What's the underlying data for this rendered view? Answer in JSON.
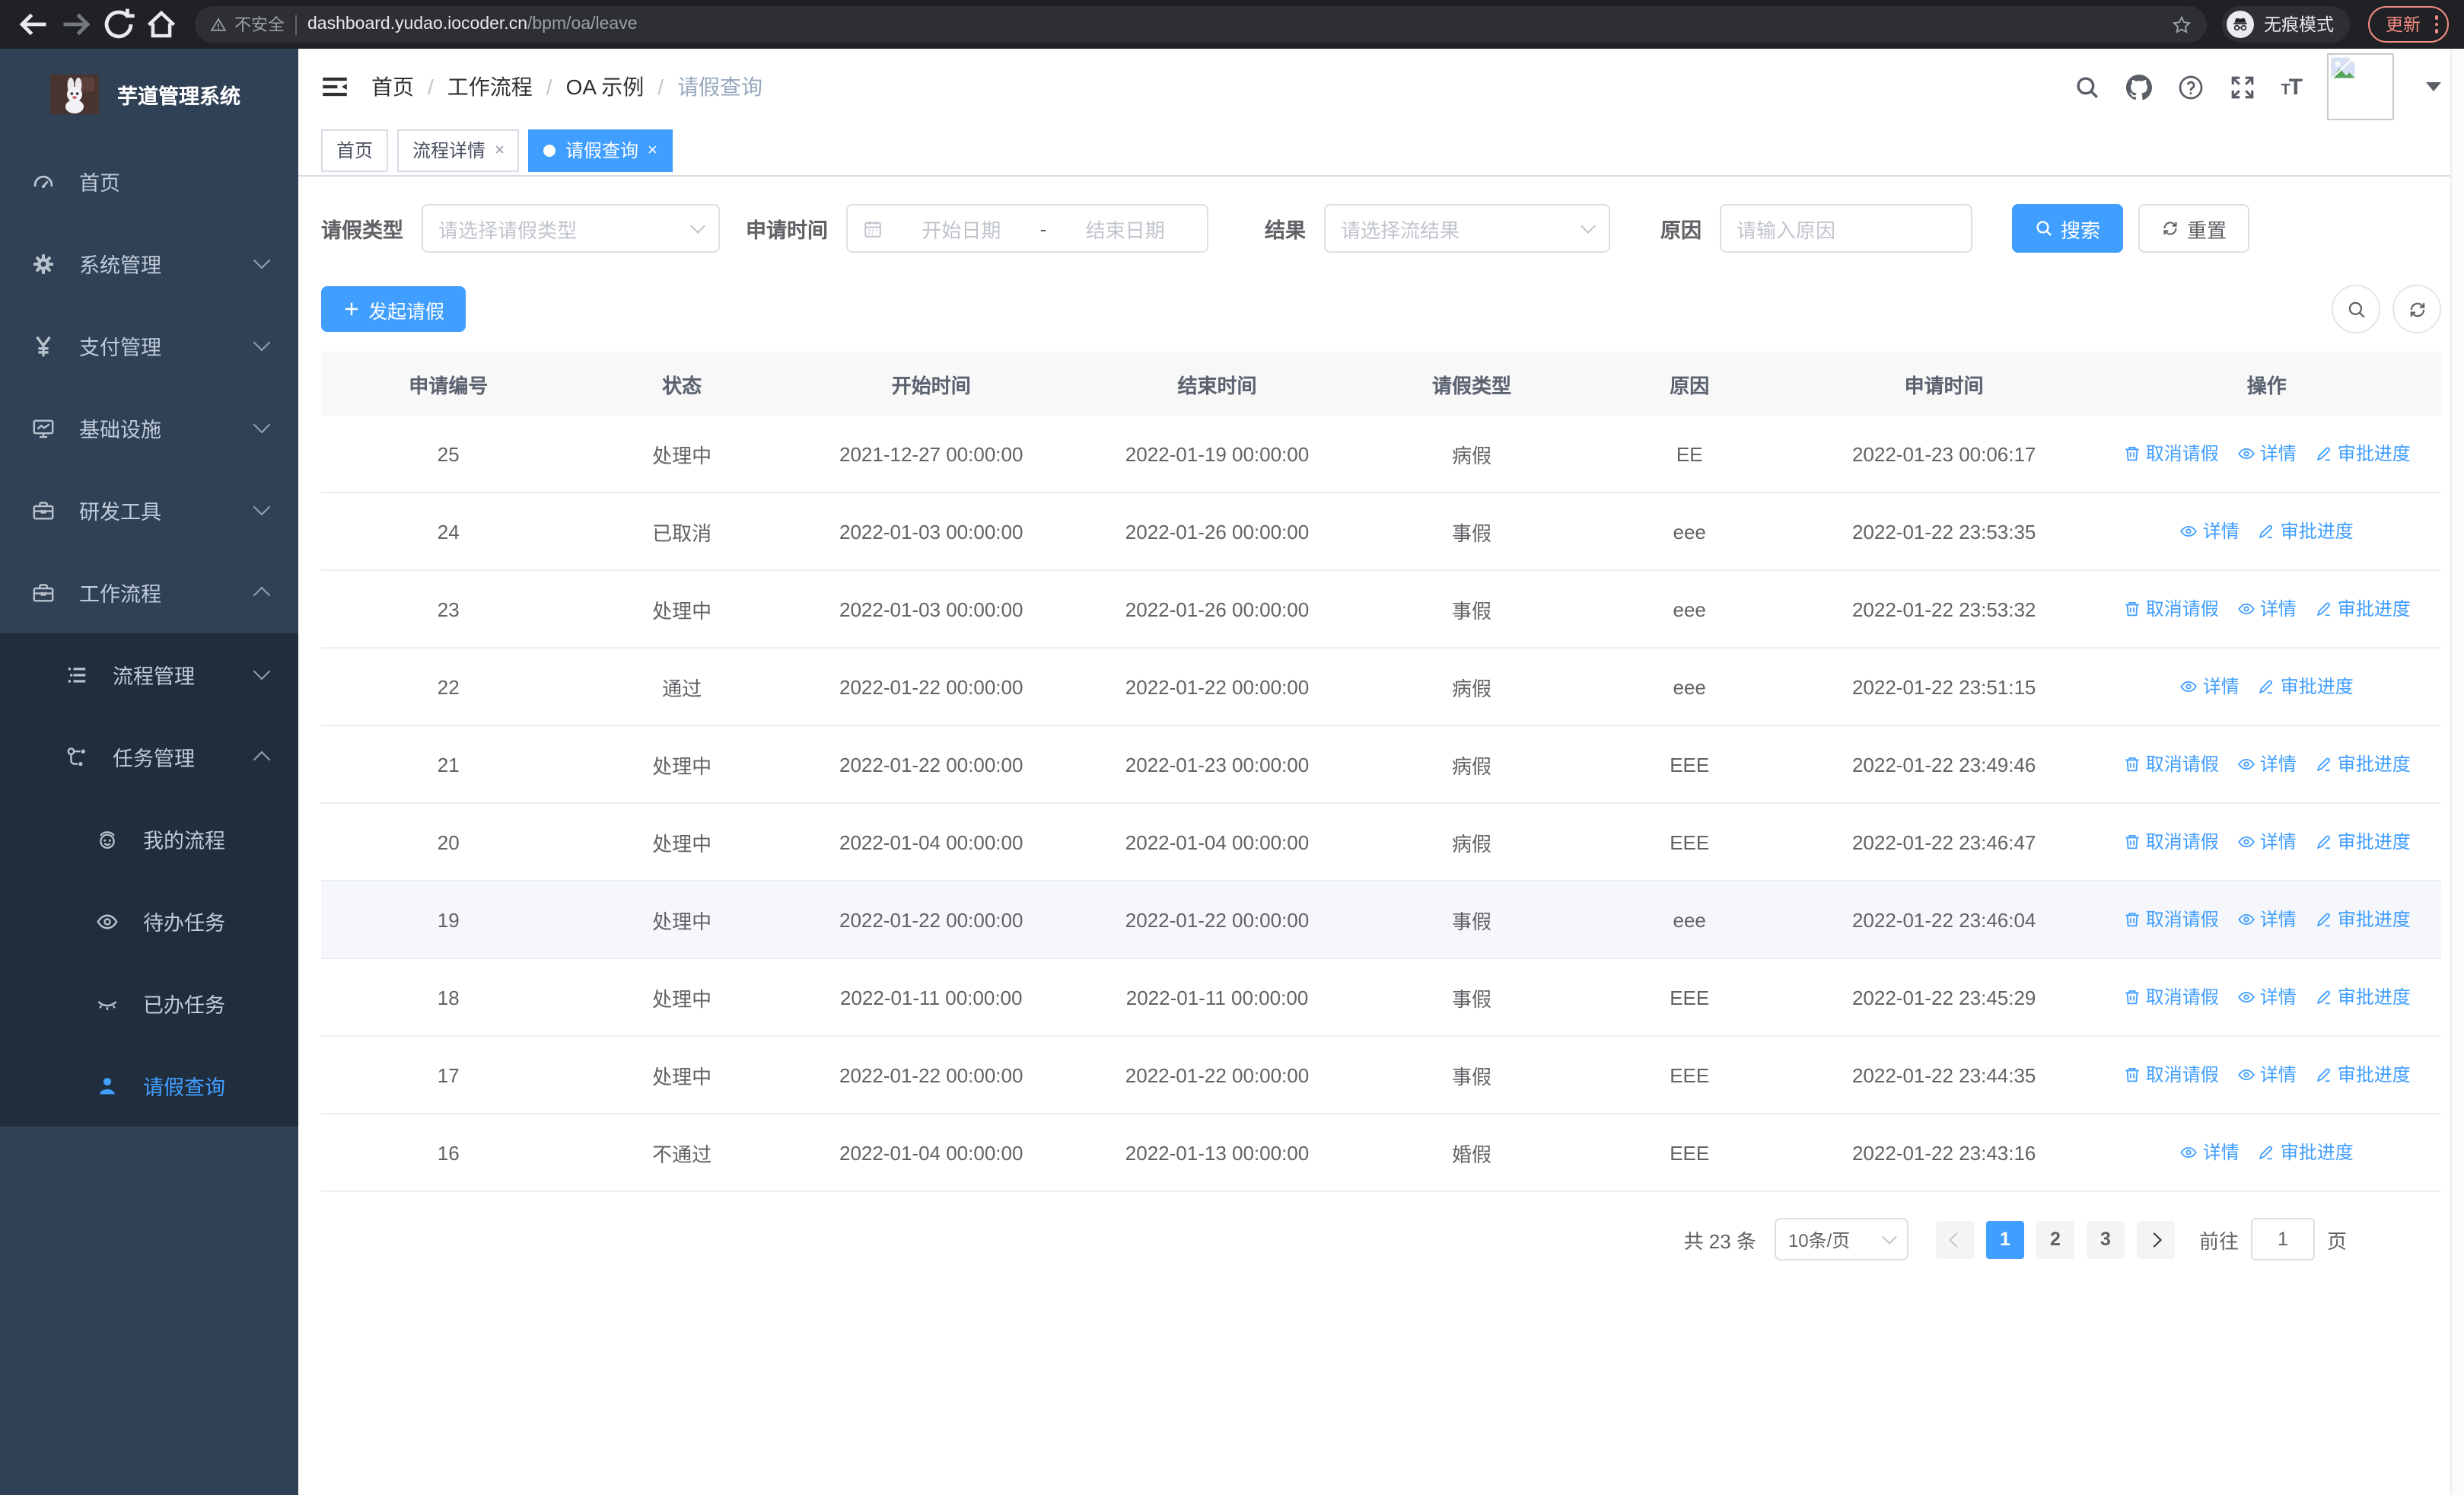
{
  "browser": {
    "security_label": "不安全",
    "url_host": "dashboard.yudao.iocoder.cn",
    "url_path": "/bpm/oa/leave",
    "incognito_label": "无痕模式",
    "update_label": "更新"
  },
  "sidebar": {
    "title": "芋道管理系统",
    "items": [
      {
        "label": "首页",
        "icon": "gauge",
        "level": 0,
        "sub": false,
        "arrow": "",
        "active": false
      },
      {
        "label": "系统管理",
        "icon": "gear",
        "level": 0,
        "sub": false,
        "arrow": "down",
        "active": false
      },
      {
        "label": "支付管理",
        "icon": "yen",
        "level": 0,
        "sub": false,
        "arrow": "down",
        "active": false
      },
      {
        "label": "基础设施",
        "icon": "monitor",
        "level": 0,
        "sub": false,
        "arrow": "down",
        "active": false
      },
      {
        "label": "研发工具",
        "icon": "toolbox",
        "level": 0,
        "sub": false,
        "arrow": "down",
        "active": false
      },
      {
        "label": "工作流程",
        "icon": "toolbox",
        "level": 0,
        "sub": false,
        "arrow": "up",
        "active": false
      },
      {
        "label": "流程管理",
        "icon": "tree",
        "level": 1,
        "sub": true,
        "arrow": "down",
        "active": false
      },
      {
        "label": "任务管理",
        "icon": "flow",
        "level": 1,
        "sub": true,
        "arrow": "up",
        "active": false
      },
      {
        "label": "我的流程",
        "icon": "face",
        "level": 2,
        "sub": true,
        "arrow": "",
        "active": false
      },
      {
        "label": "待办任务",
        "icon": "eye-open",
        "level": 2,
        "sub": true,
        "arrow": "",
        "active": false
      },
      {
        "label": "已办任务",
        "icon": "eye-closed",
        "level": 2,
        "sub": true,
        "arrow": "",
        "active": false
      },
      {
        "label": "请假查询",
        "icon": "user",
        "level": 2,
        "sub": true,
        "arrow": "",
        "active": true
      }
    ]
  },
  "header": {
    "breadcrumb": [
      {
        "label": "首页",
        "current": false
      },
      {
        "label": "工作流程",
        "current": false
      },
      {
        "label": "OA 示例",
        "current": false
      },
      {
        "label": "请假查询",
        "current": true
      }
    ]
  },
  "tabs": [
    {
      "label": "首页",
      "closable": false,
      "active": false
    },
    {
      "label": "流程详情",
      "closable": true,
      "active": false
    },
    {
      "label": "请假查询",
      "closable": true,
      "active": true
    }
  ],
  "filters": {
    "leave_type_label": "请假类型",
    "leave_type_placeholder": "请选择请假类型",
    "apply_time_label": "申请时间",
    "start_date_placeholder": "开始日期",
    "range_separator": "-",
    "end_date_placeholder": "结束日期",
    "result_label": "结果",
    "result_placeholder": "请选择流结果",
    "reason_label": "原因",
    "reason_placeholder": "请输入原因",
    "search_label": "搜索",
    "reset_label": "重置"
  },
  "toolbar": {
    "create_label": "发起请假"
  },
  "table": {
    "columns": [
      "申请编号",
      "状态",
      "开始时间",
      "结束时间",
      "请假类型",
      "原因",
      "申请时间",
      "操作"
    ],
    "actions": {
      "cancel": {
        "label": "取消请假",
        "icon": "trash"
      },
      "detail": {
        "label": "详情",
        "icon": "eye-s"
      },
      "progress": {
        "label": "审批进度",
        "icon": "pen"
      }
    },
    "rows": [
      {
        "id": "25",
        "status": "处理中",
        "start": "2021-12-27 00:00:00",
        "end": "2022-01-19 00:00:00",
        "type": "病假",
        "reason": "EE",
        "applied": "2022-01-23 00:06:17",
        "actions": [
          "cancel",
          "detail",
          "progress"
        ],
        "highlight": false
      },
      {
        "id": "24",
        "status": "已取消",
        "start": "2022-01-03 00:00:00",
        "end": "2022-01-26 00:00:00",
        "type": "事假",
        "reason": "eee",
        "applied": "2022-01-22 23:53:35",
        "actions": [
          "detail",
          "progress"
        ],
        "highlight": false
      },
      {
        "id": "23",
        "status": "处理中",
        "start": "2022-01-03 00:00:00",
        "end": "2022-01-26 00:00:00",
        "type": "事假",
        "reason": "eee",
        "applied": "2022-01-22 23:53:32",
        "actions": [
          "cancel",
          "detail",
          "progress"
        ],
        "highlight": false
      },
      {
        "id": "22",
        "status": "通过",
        "start": "2022-01-22 00:00:00",
        "end": "2022-01-22 00:00:00",
        "type": "病假",
        "reason": "eee",
        "applied": "2022-01-22 23:51:15",
        "actions": [
          "detail",
          "progress"
        ],
        "highlight": false
      },
      {
        "id": "21",
        "status": "处理中",
        "start": "2022-01-22 00:00:00",
        "end": "2022-01-23 00:00:00",
        "type": "病假",
        "reason": "EEE",
        "applied": "2022-01-22 23:49:46",
        "actions": [
          "cancel",
          "detail",
          "progress"
        ],
        "highlight": false
      },
      {
        "id": "20",
        "status": "处理中",
        "start": "2022-01-04 00:00:00",
        "end": "2022-01-04 00:00:00",
        "type": "病假",
        "reason": "EEE",
        "applied": "2022-01-22 23:46:47",
        "actions": [
          "cancel",
          "detail",
          "progress"
        ],
        "highlight": false
      },
      {
        "id": "19",
        "status": "处理中",
        "start": "2022-01-22 00:00:00",
        "end": "2022-01-22 00:00:00",
        "type": "事假",
        "reason": "eee",
        "applied": "2022-01-22 23:46:04",
        "actions": [
          "cancel",
          "detail",
          "progress"
        ],
        "highlight": true
      },
      {
        "id": "18",
        "status": "处理中",
        "start": "2022-01-11 00:00:00",
        "end": "2022-01-11 00:00:00",
        "type": "事假",
        "reason": "EEE",
        "applied": "2022-01-22 23:45:29",
        "actions": [
          "cancel",
          "detail",
          "progress"
        ],
        "highlight": false
      },
      {
        "id": "17",
        "status": "处理中",
        "start": "2022-01-22 00:00:00",
        "end": "2022-01-22 00:00:00",
        "type": "事假",
        "reason": "EEE",
        "applied": "2022-01-22 23:44:35",
        "actions": [
          "cancel",
          "detail",
          "progress"
        ],
        "highlight": false
      },
      {
        "id": "16",
        "status": "不通过",
        "start": "2022-01-04 00:00:00",
        "end": "2022-01-13 00:00:00",
        "type": "婚假",
        "reason": "EEE",
        "applied": "2022-01-22 23:43:16",
        "actions": [
          "detail",
          "progress"
        ],
        "highlight": false
      }
    ]
  },
  "pagination": {
    "total": "共 23 条",
    "page_size": "10条/页",
    "pages": [
      "1",
      "2",
      "3"
    ],
    "active_page": "1",
    "goto_label": "前往",
    "goto_value": "1",
    "unit": "页"
  },
  "colors": {
    "accent": "#409eff",
    "sidebar_bg": "#304156",
    "submenu_bg": "#1f2d3d",
    "danger_update": "#f28b82"
  }
}
